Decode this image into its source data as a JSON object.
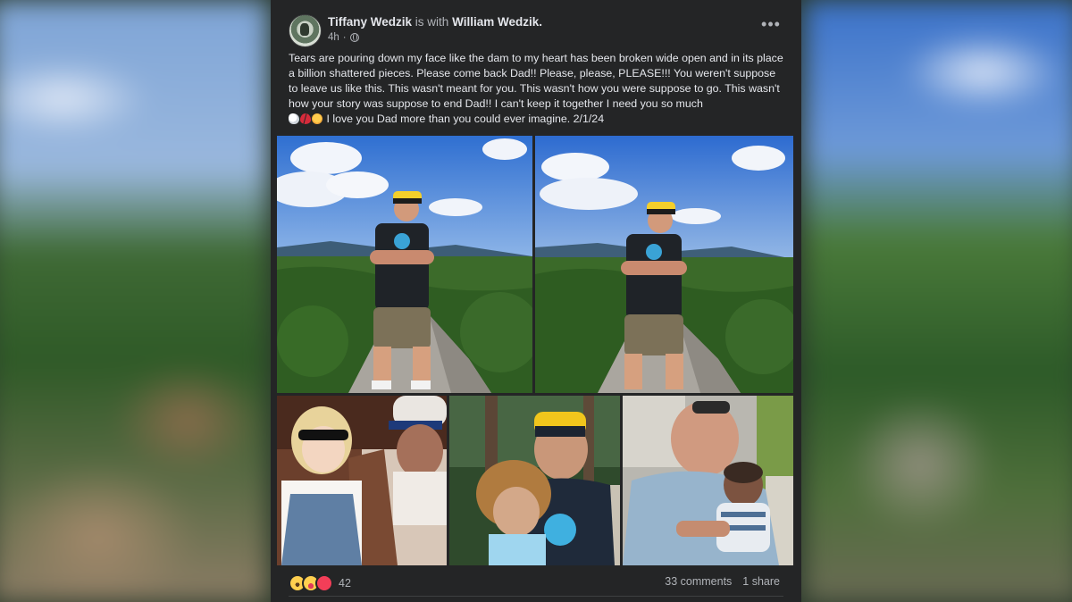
{
  "post": {
    "author": "Tiffany Wedzik",
    "with_text": "is with",
    "tagged": "William Wedzik.",
    "time": "4h",
    "time_separator": "·",
    "more_label": "•••",
    "text_line1": "Tears are pouring down my face like the dam to my heart has been broken wide open and in its place a billion shattered pieces. Please come back Dad!! Please, please, PLEASE!!! You weren't suppose to leave us like this. This wasn't meant for you. This wasn't how you were suppose to go. This wasn't how your story was suppose to end Dad!!  I can't keep it together I need you so much",
    "text_line2": " I love you Dad more than you could ever imagine. 2/1/24",
    "emojis": [
      "dove-icon",
      "broken-heart-icon",
      "crying-face-icon"
    ]
  },
  "footer": {
    "reactions": [
      "wow-icon",
      "care-icon",
      "love-icon"
    ],
    "reaction_count": "42",
    "comments": "33 comments",
    "shares": "1 share"
  },
  "colors": {
    "card_bg": "#242526",
    "text_primary": "#e4e6eb",
    "text_secondary": "#b0b3b8"
  }
}
